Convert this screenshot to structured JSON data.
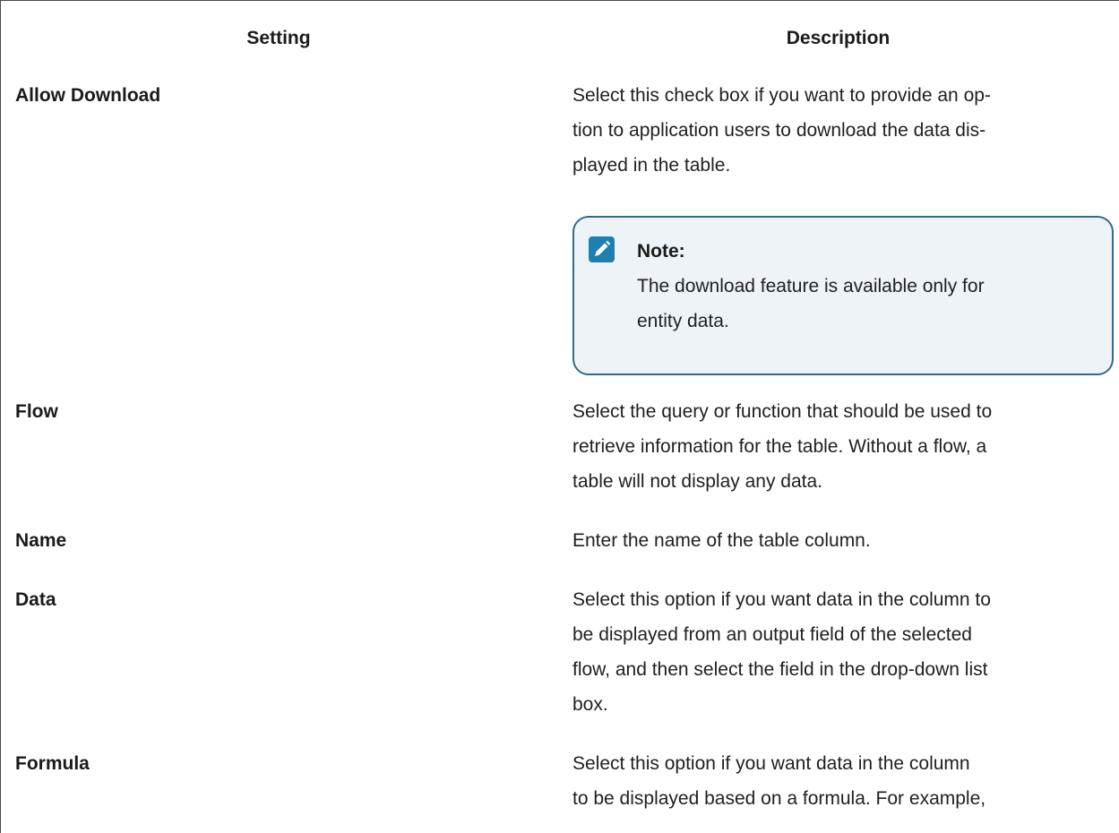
{
  "table": {
    "headers": {
      "setting": "Setting",
      "description": "Description"
    },
    "rows": [
      {
        "setting": "Allow Download",
        "description_lines": [
          "Select this check box if you want to provide an op-",
          "tion to application users to download the data dis-",
          "played in the table."
        ],
        "note": {
          "icon": "pencil-icon",
          "title": "Note:",
          "lines": [
            "The download feature is available only for",
            "entity data."
          ]
        }
      },
      {
        "setting": "Flow",
        "description_lines": [
          "Select the query or function that should be used to",
          "retrieve information for the table. Without a flow, a",
          "table will not display any data."
        ]
      },
      {
        "setting": "Name",
        "description_lines": [
          "Enter the name of the table column."
        ]
      },
      {
        "setting": "Data",
        "description_lines": [
          "Select this option if you want data in the column to",
          "be displayed from an output field of the selected",
          "flow, and then select the field in the drop-down list",
          "box."
        ]
      },
      {
        "setting": "Formula",
        "description_lines": [
          "Select this option if you want data in the column",
          "to be displayed based on a formula. For example,"
        ]
      }
    ]
  },
  "colors": {
    "note_border": "#2e6b8f",
    "note_background": "#eef3f8",
    "note_icon": "#1e7fb1"
  }
}
